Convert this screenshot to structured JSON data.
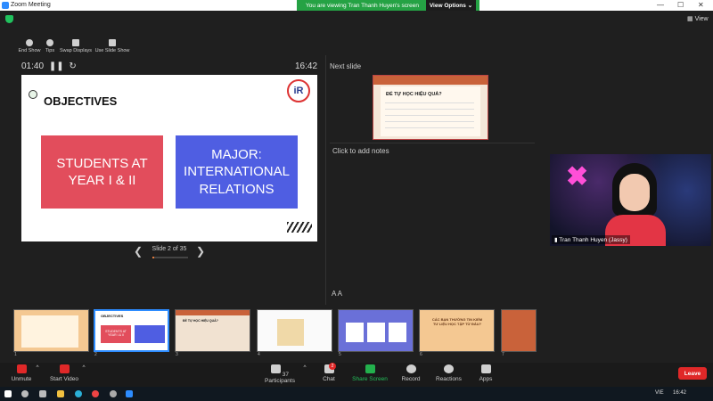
{
  "window": {
    "title": "Zoom Meeting"
  },
  "banner": {
    "message": "You are viewing Tran Thanh Huyen's screen",
    "options": "View Options ⌄"
  },
  "view_label": "View",
  "presenter_tools": [
    {
      "label": "End Show",
      "icon": "end-show-icon"
    },
    {
      "label": "Tips",
      "icon": "info-icon"
    },
    {
      "label": "Swap Displays",
      "icon": "swap-icon"
    },
    {
      "label": "Use Slide Show",
      "icon": "slideshow-icon"
    }
  ],
  "timer": "01:40",
  "clock": "16:42",
  "slide": {
    "heading": "OBJECTIVES",
    "logo": "iR",
    "box_a": "STUDENTS AT YEAR I & II",
    "box_b": "MAJOR: INTERNATIONAL RELATIONS",
    "position_label": "Slide 2 of 35",
    "progress": 0.057
  },
  "next_slide": {
    "label": "Next slide",
    "title": "ĐỂ TỰ HỌC HIỆU QUẢ?"
  },
  "notes": {
    "placeholder": "Click to add notes",
    "font_controls": "A A"
  },
  "video": {
    "name": "Tran Thanh Huyen (Jassy)"
  },
  "filmstrip": [
    {
      "num": "1",
      "text": ""
    },
    {
      "num": "2",
      "text": "STUDENTS AT YEAR I & II"
    },
    {
      "num": "3",
      "text": "ĐỂ TỰ HỌC HIỆU QUẢ?"
    },
    {
      "num": "4",
      "text": ""
    },
    {
      "num": "5",
      "text": ""
    },
    {
      "num": "6",
      "text": "CÁC BẠN THƯỜNG TIN KIẾM TƯ LIỆU HỌC TẬP TỪ ĐÂU?"
    },
    {
      "num": "7",
      "text": ""
    }
  ],
  "toolbar": {
    "unmute": "Unmute",
    "start_video": "Start Video",
    "participants": "Participants",
    "participants_count": "37",
    "chat": "Chat",
    "chat_badge": "2",
    "share_screen": "Share Screen",
    "record": "Record",
    "reactions": "Reactions",
    "apps": "Apps",
    "leave": "Leave"
  },
  "taskbar": {
    "lang": "VIE",
    "time": "16:42"
  },
  "colors": {
    "accent": "#2d8cff",
    "share_green": "#25a244",
    "leave_red": "#e02828",
    "box_a": "#e24d5c",
    "box_b": "#4f5ee2"
  }
}
